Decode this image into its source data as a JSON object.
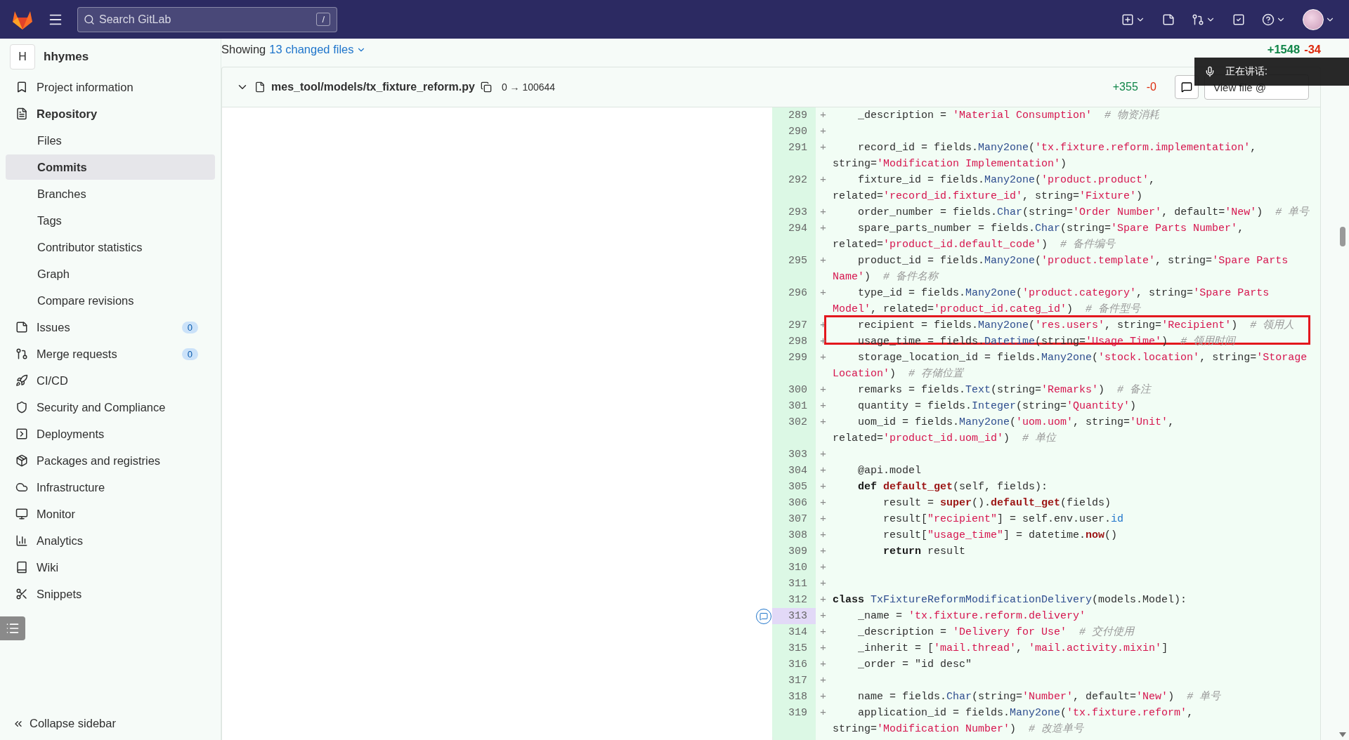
{
  "top_bar": {
    "search": {
      "placeholder": "Search GitLab",
      "shortcut": "/"
    }
  },
  "sidebar": {
    "project": {
      "avatar": "H",
      "name": "hhymes"
    },
    "items": [
      {
        "label": "Project information",
        "selected": false,
        "expanded": false
      },
      {
        "label": "Repository",
        "selected": false,
        "expanded": true,
        "children": [
          {
            "label": "Files",
            "selected": false
          },
          {
            "label": "Commits",
            "selected": true
          },
          {
            "label": "Branches",
            "selected": false
          },
          {
            "label": "Tags",
            "selected": false
          },
          {
            "label": "Contributor statistics",
            "selected": false
          },
          {
            "label": "Graph",
            "selected": false
          },
          {
            "label": "Compare revisions",
            "selected": false
          }
        ]
      },
      {
        "label": "Issues",
        "selected": false,
        "expanded": false,
        "badge": "0"
      },
      {
        "label": "Merge requests",
        "selected": false,
        "expanded": false,
        "badge": "0"
      },
      {
        "label": "CI/CD",
        "selected": false,
        "expanded": false
      },
      {
        "label": "Security and Compliance",
        "selected": false,
        "expanded": false
      },
      {
        "label": "Deployments",
        "selected": false,
        "expanded": false
      },
      {
        "label": "Packages and registries",
        "selected": false,
        "expanded": false
      },
      {
        "label": "Infrastructure",
        "selected": false,
        "expanded": false
      },
      {
        "label": "Monitor",
        "selected": false,
        "expanded": false
      },
      {
        "label": "Analytics",
        "selected": false,
        "expanded": false
      },
      {
        "label": "Wiki",
        "selected": false,
        "expanded": false
      },
      {
        "label": "Snippets",
        "selected": false,
        "expanded": false
      }
    ],
    "collapse_label": "Collapse sidebar"
  },
  "diff": {
    "showing": "Showing",
    "changed_files": "13 changed files",
    "added_total": "+1548",
    "removed_total": "-34",
    "file": {
      "path": "mes_tool/models/tx_fixture_reform.py",
      "mode": "0 → 100644",
      "added": "+355",
      "removed": "-0",
      "view_button": "View file @",
      "lines": [
        {
          "number": "289",
          "marker": "+",
          "selected": false,
          "boxed": false,
          "tokens": [
            {
              "kind": "text",
              "text": "    _description = "
            },
            {
              "kind": "string",
              "text": "'Material Consumption'"
            },
            {
              "kind": "comment",
              "text": "  # 物资消耗"
            }
          ]
        },
        {
          "number": "290",
          "marker": "+",
          "selected": false,
          "boxed": false
        },
        {
          "number": "291",
          "marker": "+",
          "selected": false,
          "boxed": false,
          "tokens": [
            {
              "kind": "text",
              "text": "    record_id = fields."
            },
            {
              "kind": "call",
              "text": "Many2one"
            },
            {
              "kind": "text",
              "text": "("
            },
            {
              "kind": "string",
              "text": "'tx.fixture.reform.implementation'"
            },
            {
              "kind": "text",
              "text": ", string="
            },
            {
              "kind": "string",
              "text": "'Modification Implementation'"
            },
            {
              "kind": "text",
              "text": ")"
            }
          ]
        },
        {
          "number": "292",
          "marker": "+",
          "selected": false,
          "boxed": false,
          "tokens": [
            {
              "kind": "text",
              "text": "    fixture_id = fields."
            },
            {
              "kind": "call",
              "text": "Many2one"
            },
            {
              "kind": "text",
              "text": "("
            },
            {
              "kind": "string",
              "text": "'product.product'"
            },
            {
              "kind": "text",
              "text": ", related="
            },
            {
              "kind": "string",
              "text": "'record_id.fixture_id'"
            },
            {
              "kind": "text",
              "text": ", string="
            },
            {
              "kind": "string",
              "text": "'Fixture'"
            },
            {
              "kind": "text",
              "text": ")"
            }
          ]
        },
        {
          "number": "293",
          "marker": "+",
          "selected": false,
          "boxed": false,
          "tokens": [
            {
              "kind": "text",
              "text": "    order_number = fields."
            },
            {
              "kind": "call",
              "text": "Char"
            },
            {
              "kind": "text",
              "text": "(string="
            },
            {
              "kind": "string",
              "text": "'Order Number'"
            },
            {
              "kind": "text",
              "text": ", default="
            },
            {
              "kind": "string",
              "text": "'New'"
            },
            {
              "kind": "text",
              "text": ")  "
            },
            {
              "kind": "comment",
              "text": "# 单号"
            }
          ]
        },
        {
          "number": "294",
          "marker": "+",
          "selected": false,
          "boxed": false,
          "tokens": [
            {
              "kind": "text",
              "text": "    spare_parts_number = fields."
            },
            {
              "kind": "call",
              "text": "Char"
            },
            {
              "kind": "text",
              "text": "(string="
            },
            {
              "kind": "string",
              "text": "'Spare Parts Number'"
            },
            {
              "kind": "text",
              "text": ", related="
            },
            {
              "kind": "string",
              "text": "'product_id.default_code'"
            },
            {
              "kind": "text",
              "text": ")  "
            },
            {
              "kind": "comment",
              "text": "# 备件编号"
            }
          ]
        },
        {
          "number": "295",
          "marker": "+",
          "selected": false,
          "boxed": false,
          "tokens": [
            {
              "kind": "text",
              "text": "    product_id = fields."
            },
            {
              "kind": "call",
              "text": "Many2one"
            },
            {
              "kind": "text",
              "text": "("
            },
            {
              "kind": "string",
              "text": "'product.template'"
            },
            {
              "kind": "text",
              "text": ", string="
            },
            {
              "kind": "string",
              "text": "'Spare Parts Name'"
            },
            {
              "kind": "text",
              "text": ")  "
            },
            {
              "kind": "comment",
              "text": "# 备件名称"
            }
          ]
        },
        {
          "number": "296",
          "marker": "+",
          "selected": false,
          "boxed": false,
          "tokens": [
            {
              "kind": "text",
              "text": "    type_id = fields."
            },
            {
              "kind": "call",
              "text": "Many2one"
            },
            {
              "kind": "text",
              "text": "("
            },
            {
              "kind": "string",
              "text": "'product.category'"
            },
            {
              "kind": "text",
              "text": ", string="
            },
            {
              "kind": "string",
              "text": "'Spare Parts Model'"
            },
            {
              "kind": "text",
              "text": ", related="
            },
            {
              "kind": "string",
              "text": "'product_id.categ_id'"
            },
            {
              "kind": "text",
              "text": ")  "
            },
            {
              "kind": "comment",
              "text": "# 备件型号"
            }
          ]
        },
        {
          "number": "297",
          "marker": "+",
          "selected": false,
          "boxed": true,
          "tokens": [
            {
              "kind": "text",
              "text": "    recipient = fields."
            },
            {
              "kind": "call",
              "text": "Many2one"
            },
            {
              "kind": "text",
              "text": "("
            },
            {
              "kind": "string",
              "text": "'res.users'"
            },
            {
              "kind": "text",
              "text": ", string="
            },
            {
              "kind": "string",
              "text": "'Recipient'"
            },
            {
              "kind": "text",
              "text": ")  "
            },
            {
              "kind": "comment",
              "text": "# 领用人"
            }
          ]
        },
        {
          "number": "298",
          "marker": "+",
          "selected": false,
          "boxed": false,
          "tokens": [
            {
              "kind": "text",
              "text": "    usage_time = fields."
            },
            {
              "kind": "call",
              "text": "Datetime"
            },
            {
              "kind": "text",
              "text": "(string="
            },
            {
              "kind": "string",
              "text": "'Usage Time'"
            },
            {
              "kind": "text",
              "text": ")  "
            },
            {
              "kind": "comment",
              "text": "# 领用时间"
            }
          ]
        },
        {
          "number": "299",
          "marker": "+",
          "selected": false,
          "boxed": false,
          "tokens": [
            {
              "kind": "text",
              "text": "    storage_location_id = fields."
            },
            {
              "kind": "call",
              "text": "Many2one"
            },
            {
              "kind": "text",
              "text": "("
            },
            {
              "kind": "string",
              "text": "'stock.location'"
            },
            {
              "kind": "text",
              "text": ", string="
            },
            {
              "kind": "string",
              "text": "'Storage Location'"
            },
            {
              "kind": "text",
              "text": ")  "
            },
            {
              "kind": "comment",
              "text": "# 存储位置"
            }
          ]
        },
        {
          "number": "300",
          "marker": "+",
          "selected": false,
          "boxed": false,
          "tokens": [
            {
              "kind": "text",
              "text": "    remarks = fields."
            },
            {
              "kind": "call",
              "text": "Text"
            },
            {
              "kind": "text",
              "text": "(string="
            },
            {
              "kind": "string",
              "text": "'Remarks'"
            },
            {
              "kind": "text",
              "text": ")  "
            },
            {
              "kind": "comment",
              "text": "# 备注"
            }
          ]
        },
        {
          "number": "301",
          "marker": "+",
          "selected": false,
          "boxed": false,
          "tokens": [
            {
              "kind": "text",
              "text": "    quantity = fields."
            },
            {
              "kind": "call",
              "text": "Integer"
            },
            {
              "kind": "text",
              "text": "(string="
            },
            {
              "kind": "string",
              "text": "'Quantity'"
            },
            {
              "kind": "text",
              "text": ")"
            }
          ]
        },
        {
          "number": "302",
          "marker": "+",
          "selected": false,
          "boxed": false,
          "tokens": [
            {
              "kind": "text",
              "text": "    uom_id = fields."
            },
            {
              "kind": "call",
              "text": "Many2one"
            },
            {
              "kind": "text",
              "text": "("
            },
            {
              "kind": "string",
              "text": "'uom.uom'"
            },
            {
              "kind": "text",
              "text": ", string="
            },
            {
              "kind": "string",
              "text": "'Unit'"
            },
            {
              "kind": "text",
              "text": ", related="
            },
            {
              "kind": "string",
              "text": "'product_id.uom_id'"
            },
            {
              "kind": "text",
              "text": ")  "
            },
            {
              "kind": "comment",
              "text": "# 单位"
            }
          ]
        },
        {
          "number": "303",
          "marker": "+",
          "selected": false,
          "boxed": false
        },
        {
          "number": "304",
          "marker": "+",
          "selected": false,
          "boxed": false,
          "tokens": [
            {
              "kind": "text",
              "text": "    @api.model"
            }
          ]
        },
        {
          "number": "305",
          "marker": "+",
          "selected": false,
          "boxed": false,
          "tokens": [
            {
              "kind": "keyword",
              "text": "    def"
            },
            {
              "kind": "function",
              "text": " default_get"
            },
            {
              "kind": "text",
              "text": "(self, fields):"
            }
          ]
        },
        {
          "number": "306",
          "marker": "+",
          "selected": false,
          "boxed": false,
          "tokens": [
            {
              "kind": "text",
              "text": "        result = "
            },
            {
              "kind": "function",
              "text": "super"
            },
            {
              "kind": "text",
              "text": "()."
            },
            {
              "kind": "function",
              "text": "default_get"
            },
            {
              "kind": "text",
              "text": "(fields)"
            }
          ]
        },
        {
          "number": "307",
          "marker": "+",
          "selected": false,
          "boxed": false,
          "tokens": [
            {
              "kind": "text",
              "text": "        result["
            },
            {
              "kind": "string",
              "text": "\"recipient\""
            },
            {
              "kind": "text",
              "text": "] = self.env.user."
            },
            {
              "kind": "attr",
              "text": "id"
            }
          ]
        },
        {
          "number": "308",
          "marker": "+",
          "selected": false,
          "boxed": false,
          "tokens": [
            {
              "kind": "text",
              "text": "        result["
            },
            {
              "kind": "string",
              "text": "\"usage_time\""
            },
            {
              "kind": "text",
              "text": "] = datetime."
            },
            {
              "kind": "function",
              "text": "now"
            },
            {
              "kind": "text",
              "text": "()"
            }
          ]
        },
        {
          "number": "309",
          "marker": "+",
          "selected": false,
          "boxed": false,
          "tokens": [
            {
              "kind": "keyword",
              "text": "        return"
            },
            {
              "kind": "text",
              "text": " result"
            }
          ]
        },
        {
          "number": "310",
          "marker": "+",
          "selected": false,
          "boxed": false
        },
        {
          "number": "311",
          "marker": "+",
          "selected": false,
          "boxed": false
        },
        {
          "number": "312",
          "marker": "+",
          "selected": false,
          "boxed": false,
          "tokens": [
            {
              "kind": "keyword",
              "text": "class"
            },
            {
              "kind": "call",
              "text": " TxFixtureReformModificationDelivery"
            },
            {
              "kind": "text",
              "text": "(models.Model):"
            }
          ]
        },
        {
          "number": "313",
          "marker": "+",
          "selected": true,
          "boxed": false,
          "tokens": [
            {
              "kind": "text",
              "text": "    _name = "
            },
            {
              "kind": "string",
              "text": "'tx.fixture.reform.delivery'"
            }
          ]
        },
        {
          "number": "314",
          "marker": "+",
          "selected": false,
          "boxed": false,
          "tokens": [
            {
              "kind": "text",
              "text": "    _description = "
            },
            {
              "kind": "string",
              "text": "'Delivery for Use'"
            },
            {
              "kind": "comment",
              "text": "  # 交付使用"
            }
          ]
        },
        {
          "number": "315",
          "marker": "+",
          "selected": false,
          "boxed": false,
          "tokens": [
            {
              "kind": "text",
              "text": "    _inherit = ["
            },
            {
              "kind": "string",
              "text": "'mail.thread'"
            },
            {
              "kind": "text",
              "text": ", "
            },
            {
              "kind": "string",
              "text": "'mail.activity.mixin'"
            },
            {
              "kind": "text",
              "text": "]"
            }
          ]
        },
        {
          "number": "316",
          "marker": "+",
          "selected": false,
          "boxed": false,
          "tokens": [
            {
              "kind": "text",
              "text": "    _order = \"id desc\""
            }
          ]
        },
        {
          "number": "317",
          "marker": "+",
          "selected": false,
          "boxed": false
        },
        {
          "number": "318",
          "marker": "+",
          "selected": false,
          "boxed": false,
          "tokens": [
            {
              "kind": "text",
              "text": "    name = fields."
            },
            {
              "kind": "call",
              "text": "Char"
            },
            {
              "kind": "text",
              "text": "(string="
            },
            {
              "kind": "string",
              "text": "'Number'"
            },
            {
              "kind": "text",
              "text": ", default="
            },
            {
              "kind": "string",
              "text": "'New'"
            },
            {
              "kind": "text",
              "text": ")  "
            },
            {
              "kind": "comment",
              "text": "# 单号"
            }
          ]
        },
        {
          "number": "319",
          "marker": "+",
          "selected": false,
          "boxed": false,
          "tokens": [
            {
              "kind": "text",
              "text": "    application_id = fields."
            },
            {
              "kind": "call",
              "text": "Many2one"
            },
            {
              "kind": "text",
              "text": "("
            },
            {
              "kind": "string",
              "text": "'tx.fixture.reform'"
            },
            {
              "kind": "text",
              "text": ", string="
            },
            {
              "kind": "string",
              "text": "'Modification Number'"
            },
            {
              "kind": "text",
              "text": ")  "
            },
            {
              "kind": "comment",
              "text": "# 改造单号"
            }
          ]
        }
      ]
    }
  },
  "overlay": {
    "text": "正在讲话:"
  }
}
